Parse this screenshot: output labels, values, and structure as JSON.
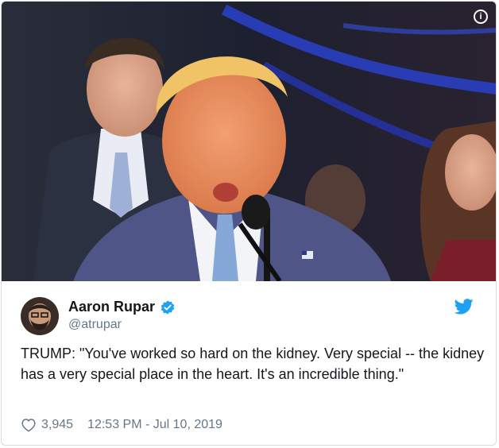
{
  "tweet": {
    "author": {
      "display_name": "Aaron Rupar",
      "handle": "@atrupar",
      "verified": true
    },
    "text": "TRUMP: \"You've worked so hard on the kidney. Very special -- the kidney has a very special place in the heart. It's an incredible thing.\"",
    "likes": "3,945",
    "timestamp": "12:53 PM - Jul 10, 2019"
  },
  "icons": {
    "info": "info-icon",
    "verified": "verified-badge-icon",
    "brand": "twitter-bird-icon",
    "like": "heart-icon"
  },
  "colors": {
    "twitter_blue": "#1da1f2",
    "text": "#14171a",
    "secondary_text": "#657786",
    "border": "#d8dde2"
  }
}
